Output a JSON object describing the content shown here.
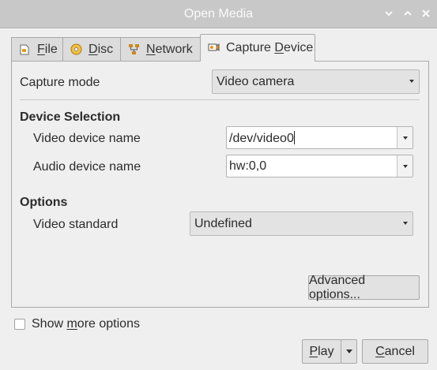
{
  "window": {
    "title": "Open Media",
    "controls": [
      "minimize-icon",
      "maximize-icon",
      "close-icon"
    ]
  },
  "tabs": [
    {
      "prefix": "",
      "mnemonic": "F",
      "rest": "ile",
      "icon": "file-icon"
    },
    {
      "prefix": "",
      "mnemonic": "D",
      "rest": "isc",
      "icon": "disc-icon"
    },
    {
      "prefix": "",
      "mnemonic": "N",
      "rest": "etwork",
      "icon": "network-icon"
    },
    {
      "prefix": "Capture ",
      "mnemonic": "D",
      "rest": "evice",
      "icon": "capture-device-icon",
      "active": true
    }
  ],
  "capture_mode": {
    "label": "Capture mode",
    "value": "Video camera"
  },
  "device_selection": {
    "heading": "Device Selection",
    "video_label": "Video device name",
    "video_value": "/dev/video0",
    "audio_label": "Audio device name",
    "audio_value": "hw:0,0"
  },
  "options": {
    "heading": "Options",
    "standard_label": "Video standard",
    "standard_value": "Undefined"
  },
  "advanced_button": "Advanced options...",
  "show_more": {
    "prefix": "Show ",
    "mnemonic": "m",
    "rest": "ore options",
    "checked": false
  },
  "footer": {
    "play_mnemonic": "P",
    "play_rest": "lay",
    "cancel_mnemonic": "C",
    "cancel_rest": "ancel"
  }
}
